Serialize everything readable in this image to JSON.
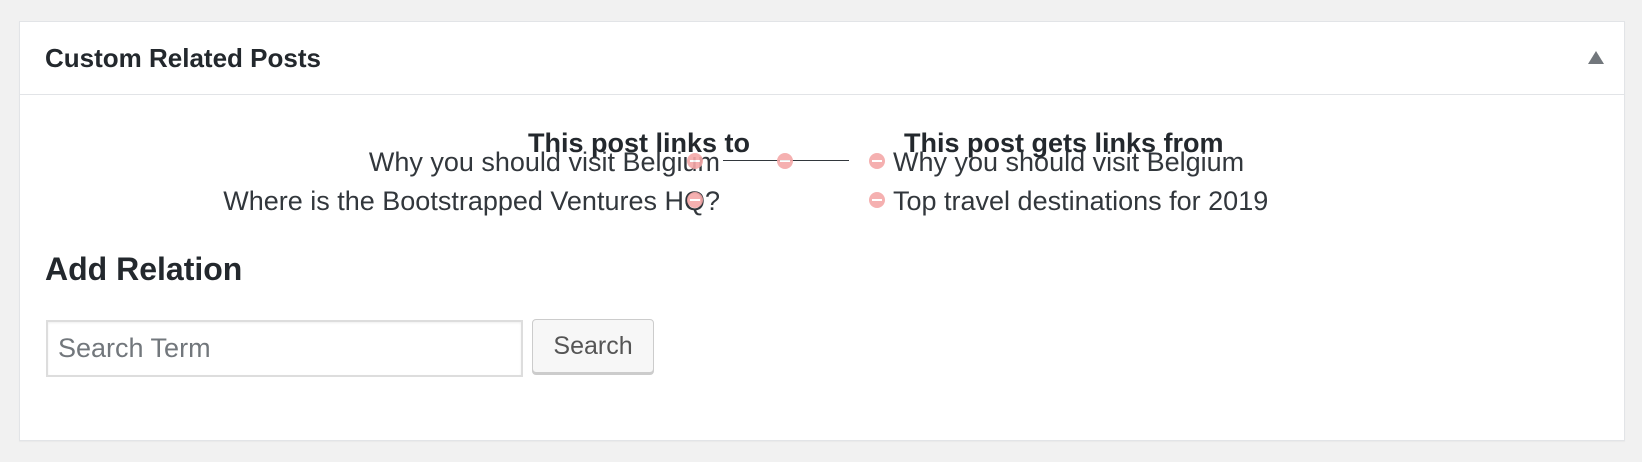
{
  "metabox": {
    "title": "Custom Related Posts",
    "toggle_icon": "triangle-up-icon"
  },
  "relations": {
    "links_to": {
      "heading": "This post links to",
      "items": [
        "Why you should visit Belgium",
        "Where is the Bootstrapped Ventures HQ?"
      ]
    },
    "links_from": {
      "heading": "This post gets links from",
      "items": [
        "Why you should visit Belgium",
        "Top travel destinations for 2019"
      ]
    },
    "remove_icon": "remove-circle-icon",
    "remove_icon_color": "#f4a8a8"
  },
  "add_relation": {
    "heading": "Add Relation",
    "search_placeholder": "Search Term",
    "search_value": "",
    "search_button_label": "Search"
  }
}
